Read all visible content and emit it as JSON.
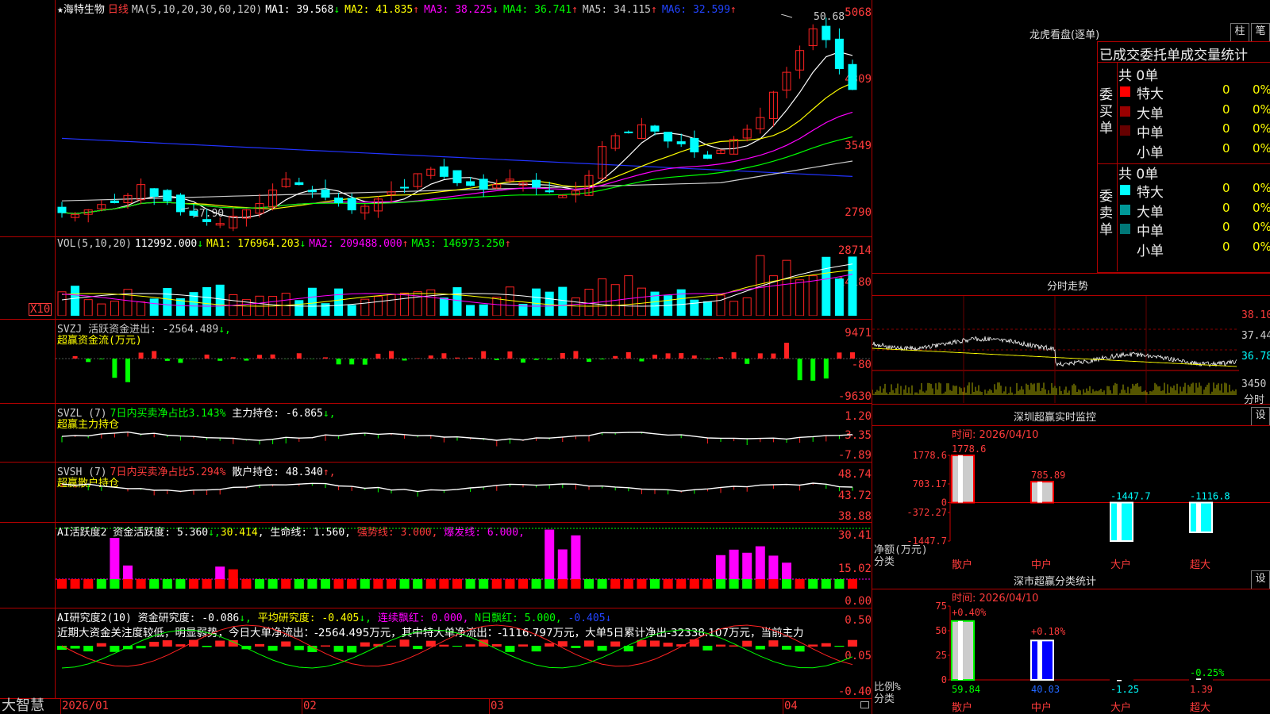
{
  "stock": {
    "name": "★海特生物",
    "period": "日线",
    "ma_params": "MA(5,10,20,30,60,120)"
  },
  "ma_header": [
    {
      "label": "MA1:",
      "value": "39.568",
      "arrow": "↓",
      "color": "#ffffff"
    },
    {
      "label": "MA2:",
      "value": "41.835",
      "arrow": "↑",
      "color": "#ffff00"
    },
    {
      "label": "MA3:",
      "value": "38.225",
      "arrow": "↓",
      "color": "#ff00ff"
    },
    {
      "label": "MA4:",
      "value": "36.741",
      "arrow": "↑",
      "color": "#00ff00"
    },
    {
      "label": "MA5:",
      "value": "34.115",
      "arrow": "↑",
      "color": "#cccccc"
    },
    {
      "label": "MA6:",
      "value": "32.599",
      "arrow": "↑",
      "color": "#2244ff"
    }
  ],
  "price_axis": [
    "5068",
    "4309",
    "3549",
    "2790"
  ],
  "price_annotations": {
    "high": "50.68",
    "low": "27.90"
  },
  "vol_header": {
    "title": "VOL(5,10,20)",
    "v": "112992.000",
    "a": "↓",
    "ma1": "MA1: 176964.203",
    "ma1a": "↓",
    "ma2": "MA2: 209488.000",
    "ma2a": "↑",
    "ma3": "MA3: 146973.250",
    "ma3a": "↑"
  },
  "vol_axis": [
    "28714",
    "14180"
  ],
  "vol_unit": "X10",
  "svzj": {
    "header": "SVZJ  活跃资金进出: -2564.489",
    "arrow": "↓,",
    "sub": "超赢资金流(万元)",
    "axis": [
      "9471",
      "-80",
      "-9630"
    ]
  },
  "svzl": {
    "title": "SVZL (7)",
    "desc": "7日内买卖净占比3.143%",
    "mid": " 主力持仓: -6.865",
    "arrow": "↓,",
    "sub": "超赢主力持仓",
    "axis": [
      "1.20",
      "-3.35",
      "-7.89"
    ]
  },
  "svsh": {
    "title": "SVSH (7)",
    "desc": "7日内买卖净占比5.294%",
    "mid": " 散户持仓: 48.340",
    "arrow": "↑,",
    "sub": "超赢散户持仓",
    "axis": [
      "48.74",
      "43.72",
      "38.88"
    ]
  },
  "ai1": {
    "title": "AI活跃度2 资金活跃度: 5.360",
    "a1": "↓,",
    "v2": "30.414",
    "s2": ", 生命线: 1.560,",
    "s3": " 强势线: 3.000,",
    "s4": " 爆发线: 6.000,",
    "axis": [
      "30.41",
      "15.02",
      "0.00"
    ]
  },
  "ai2": {
    "title": "AI研究度2(10) 资金研究度: -0.086",
    "a1": "↓,",
    "s2": " 平均研究度: -0.405",
    "a2": "↓,",
    "s3": " 连续飘红: 0.000,",
    "s4": " N日飘红: 5.000,",
    "s5": " -0.405",
    "a5": "↓",
    "comment": "近期大资金关注度较低，明显弱势，今日大单净流出：-2564.495万元，其中特大单净流出：-1116.797万元，大单5日累计净出-32338.107万元，当前主力",
    "axis": [
      "0.50",
      "0.05",
      "-0.40"
    ]
  },
  "date_axis": [
    "2026/01",
    "02",
    "03",
    "04"
  ],
  "brand": "大智慧",
  "lh": {
    "title": "龙虎看盘(逐单)",
    "btn1": "柱",
    "btn2": "笔",
    "tabs": "已成交委托单成交量统计",
    "buy": {
      "label": "委买单",
      "total": "共 0单",
      "rows": [
        {
          "name": "特大",
          "val": "0",
          "pct": "0%",
          "color": "#ff0000"
        },
        {
          "name": "大单",
          "val": "0",
          "pct": "0%",
          "color": "#990000"
        },
        {
          "name": "中单",
          "val": "0",
          "pct": "0%",
          "color": "#660000"
        },
        {
          "name": "小单",
          "val": "0",
          "pct": "0%",
          "color": "#000000"
        }
      ]
    },
    "sell": {
      "label": "委卖单",
      "total": "共 0单",
      "rows": [
        {
          "name": "特大",
          "val": "0",
          "pct": "0%",
          "color": "#00ffff"
        },
        {
          "name": "大单",
          "val": "0",
          "pct": "0%",
          "color": "#009999"
        },
        {
          "name": "中单",
          "val": "0",
          "pct": "0%",
          "color": "#007777"
        },
        {
          "name": "小单",
          "val": "0",
          "pct": "0%",
          "color": "#000000"
        }
      ]
    }
  },
  "fenshi": {
    "title": "分时走势",
    "axis": [
      "38.10",
      "37.44",
      "36.78",
      "3450"
    ],
    "tag": "分时"
  },
  "sz_monitor": {
    "title": "深圳超赢实时监控",
    "btn": "设",
    "time": "时间: 2026/04/10",
    "ylabel": "净额(万元)",
    "xlabel": "分类",
    "axis": [
      "1778.6",
      "703.17",
      "0",
      "-372.27",
      "-1447.7"
    ]
  },
  "sz_class": {
    "title": "深市超赢分类统计",
    "btn": "设",
    "time": "时间: 2026/04/10",
    "ylabel": "比例%",
    "xlabel": "分类",
    "axis": [
      "75",
      "50",
      "25",
      "0"
    ]
  },
  "chart_data": [
    {
      "type": "bar",
      "title": "深圳超赢实时监控",
      "categories": [
        "散户",
        "中户",
        "大户",
        "超大"
      ],
      "values": [
        1778.6,
        785.89,
        -1447.7,
        -1116.8
      ],
      "value_labels": [
        "1778.6",
        "785.89",
        "-1447.7",
        "-1116.8"
      ],
      "ylim": [
        -1447.7,
        1778.6
      ],
      "ylabel": "净额(万元)"
    },
    {
      "type": "bar",
      "title": "深市超赢分类统计",
      "categories": [
        "散户",
        "中户",
        "大户",
        "超大"
      ],
      "values": [
        59.84,
        40.03,
        -1.25,
        1.39
      ],
      "value_labels": [
        "59.84",
        "40.03",
        "-1.25",
        "1.39"
      ],
      "changes": [
        "+0.40%",
        "+0.18%",
        "",
        "-0.25%"
      ],
      "ylim": [
        0,
        75
      ],
      "ylabel": "比例%"
    }
  ]
}
